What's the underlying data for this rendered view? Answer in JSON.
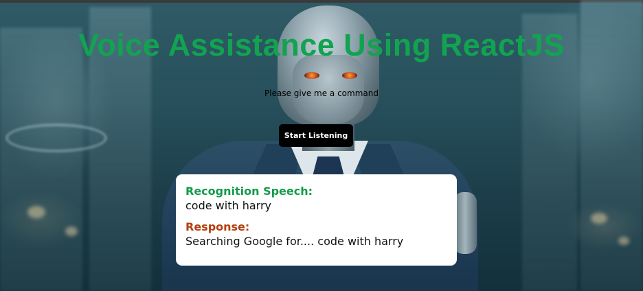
{
  "app": {
    "title": "Voice Assistance Using ReactJS",
    "prompt": "Please give me a command",
    "start_button_label": "Start Listening"
  },
  "result": {
    "recognition_label": "Recognition Speech:",
    "recognition_text": "code with harry",
    "response_label": "Response:",
    "response_text": "Searching Google for.... code with harry"
  },
  "colors": {
    "title": "#12a350",
    "recognition_label": "#129b4a",
    "response_label": "#b5400e",
    "button_bg": "#000000",
    "card_bg": "#ffffff"
  },
  "background": {
    "description_icon": "robot-in-suit-city-background"
  }
}
